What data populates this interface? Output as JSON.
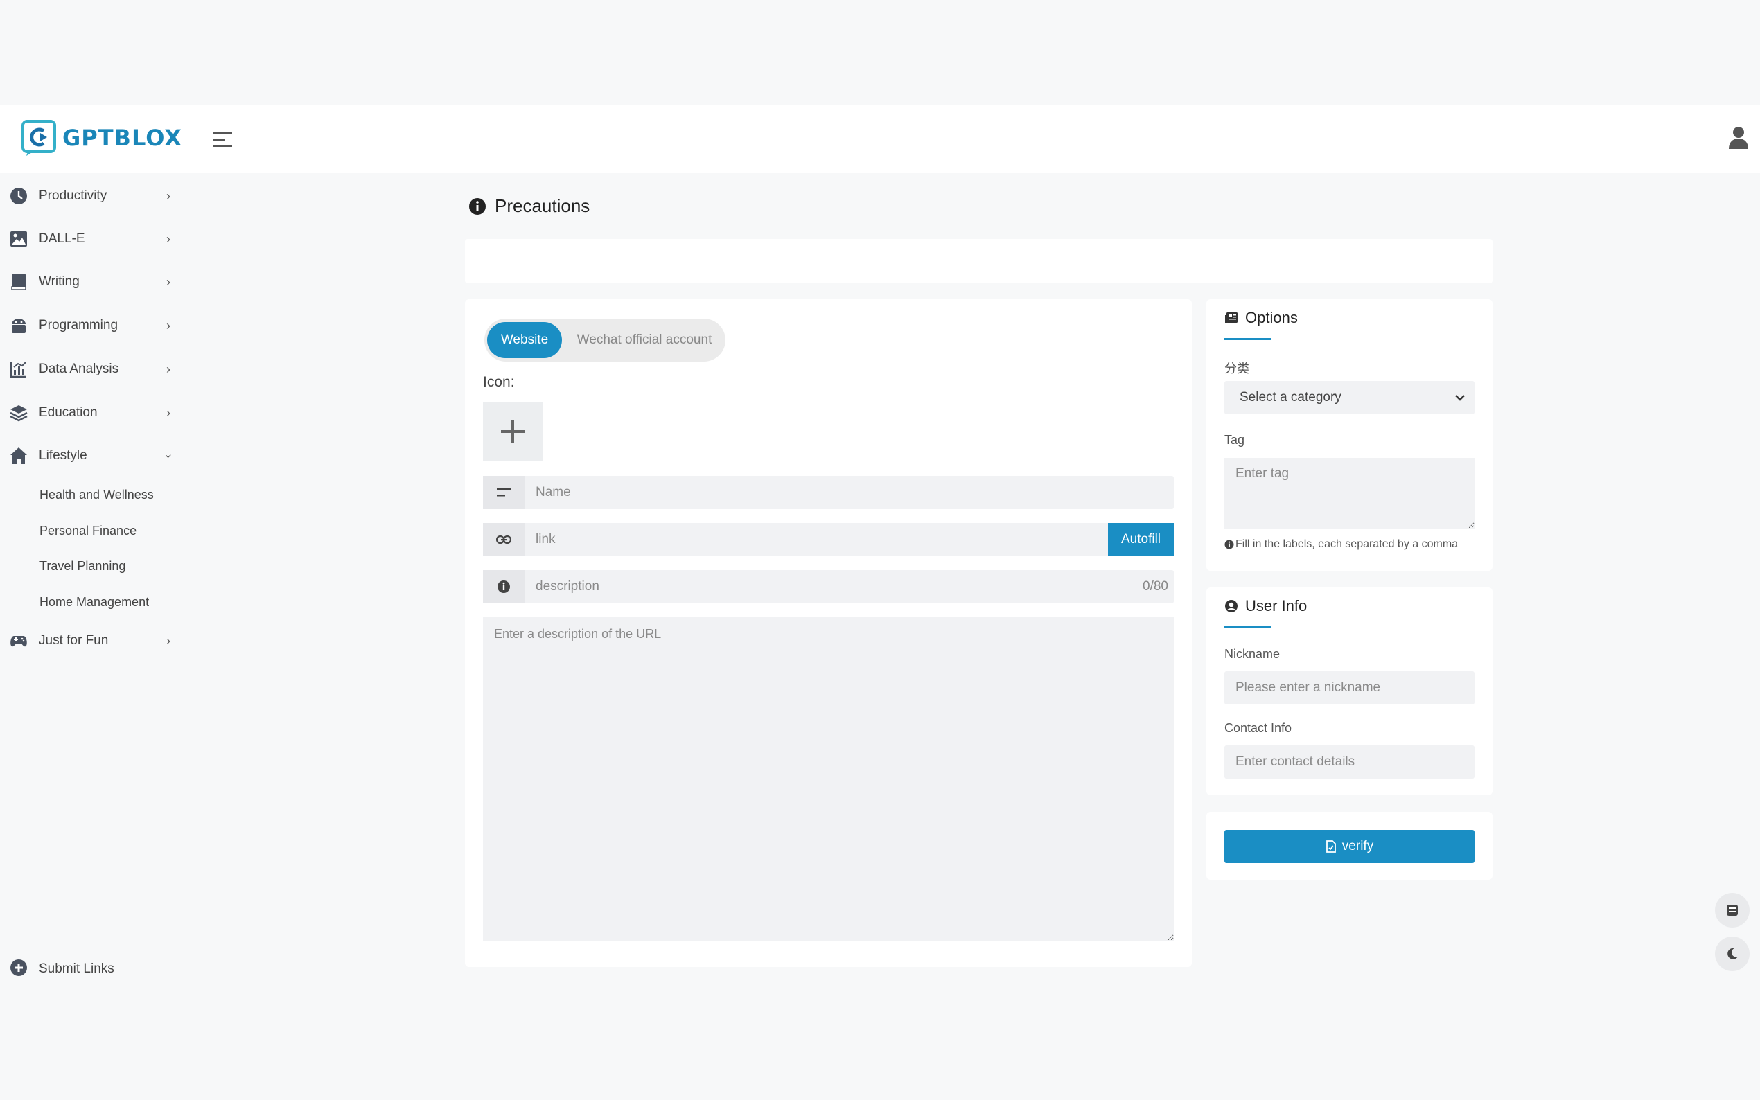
{
  "brand": {
    "name": "GPTBLOX",
    "color": "#1a86b8"
  },
  "accent_color": "#1a8ec4",
  "sidebar": {
    "items": [
      {
        "label": "Productivity",
        "icon": "clock-icon"
      },
      {
        "label": "DALL-E",
        "icon": "image-icon"
      },
      {
        "label": "Writing",
        "icon": "book-icon"
      },
      {
        "label": "Programming",
        "icon": "android-icon"
      },
      {
        "label": "Data Analysis",
        "icon": "chart-icon"
      },
      {
        "label": "Education",
        "icon": "layers-icon"
      },
      {
        "label": "Lifestyle",
        "icon": "home-icon",
        "expanded": true,
        "children": [
          "Health and Wellness",
          "Personal Finance",
          "Travel Planning",
          "Home Management"
        ]
      },
      {
        "label": "Just for Fun",
        "icon": "gamepad-icon"
      }
    ],
    "submit_links": "Submit Links"
  },
  "precautions": {
    "title": "Precautions"
  },
  "form": {
    "tabs": {
      "active": "Website",
      "other": "Wechat official account"
    },
    "icon_label": "Icon:",
    "name_placeholder": "Name",
    "link_placeholder": "link",
    "autofill_label": "Autofill",
    "description_placeholder": "description",
    "description_counter": "0/80",
    "long_description_placeholder": "Enter a description of the URL"
  },
  "options": {
    "title": "Options",
    "category_label": "分类",
    "category_selected": "Select a category",
    "tag_label": "Tag",
    "tag_placeholder": "Enter tag",
    "tag_hint": "Fill in the labels, each separated by a comma"
  },
  "user_info": {
    "title": "User Info",
    "nickname_label": "Nickname",
    "nickname_placeholder": "Please enter a nickname",
    "contact_label": "Contact Info",
    "contact_placeholder": "Enter contact details"
  },
  "verify_label": "verify"
}
